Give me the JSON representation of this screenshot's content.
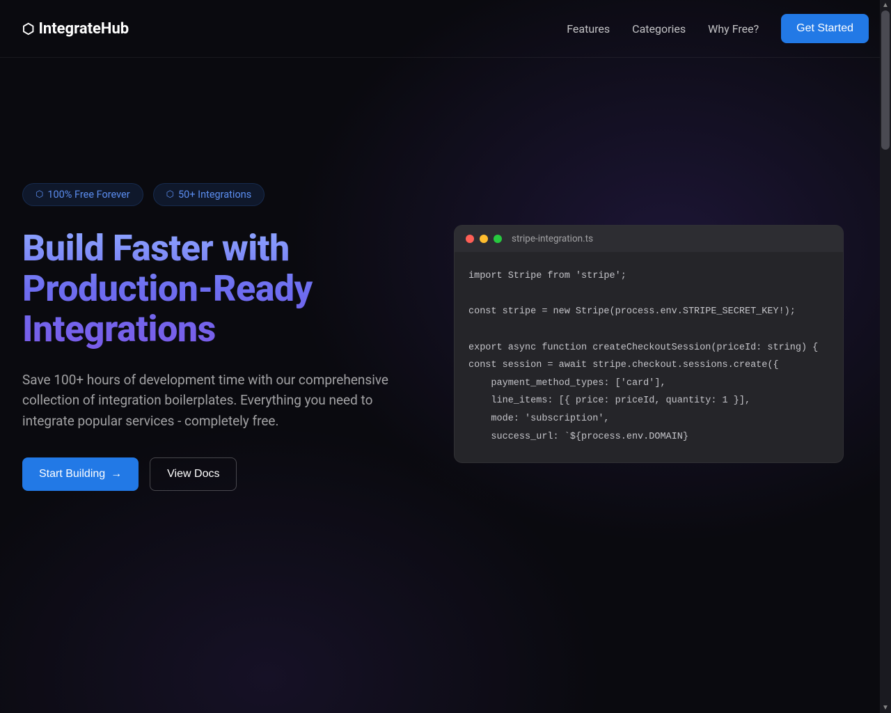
{
  "nav": {
    "logo_icon": "⬡",
    "logo_text": "IntegrateHub",
    "links": [
      "Features",
      "Categories",
      "Why Free?"
    ],
    "cta": "Get Started"
  },
  "hero": {
    "badges": [
      {
        "icon": "⬡",
        "text": "100% Free Forever"
      },
      {
        "icon": "⬡",
        "text": "50+ Integrations"
      }
    ],
    "headline": "Build Faster with Production-Ready Integrations",
    "subhead": "Save 100+ hours of development time with our comprehensive collection of integration boilerplates. Everything you need to integrate popular services - completely free.",
    "primary_cta": "Start Building",
    "primary_cta_arrow": "→",
    "secondary_cta": "View Docs"
  },
  "code": {
    "filename": "stripe-integration.ts",
    "content": "import Stripe from 'stripe';\n\nconst stripe = new Stripe(process.env.STRIPE_SECRET_KEY!);\n\nexport async function createCheckoutSession(priceId: string) {\nconst session = await stripe.checkout.sessions.create({\n    payment_method_types: ['card'],\n    line_items: [{ price: priceId, quantity: 1 }],\n    mode: 'subscription',\n    success_url: `${process.env.DOMAIN}"
  }
}
